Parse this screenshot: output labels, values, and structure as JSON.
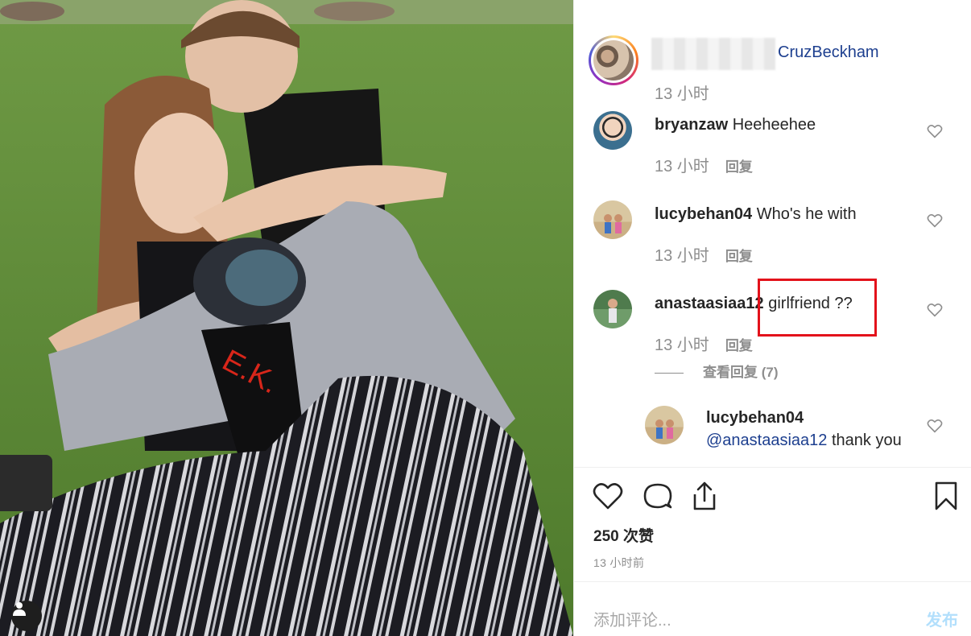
{
  "post": {
    "author": "CruzBeckham",
    "time": "13 小时",
    "likes": "250 次赞",
    "posted_ago": "13 小时前"
  },
  "comments": [
    {
      "user": "bryanzaw",
      "text": "Heeheehee",
      "time": "13 小时",
      "reply": "回复"
    },
    {
      "user": "lucybehan04",
      "text": "Who's he with",
      "time": "13 小时",
      "reply": "回复"
    },
    {
      "user": "anastaasiaa12",
      "text": "girlfriend ??",
      "time": "13 小时",
      "reply": "回复"
    }
  ],
  "view_replies": "查看回复 (7)",
  "reply": {
    "user": "lucybehan04",
    "mention": "@anastaasiaa12",
    "text": "thank you"
  },
  "input": {
    "placeholder": "添加评论...",
    "post_label": "发布"
  },
  "colors": {
    "highlight": "#e3121b",
    "link": "#1d3f8f",
    "post_button": "#b2dffc"
  },
  "icons": [
    "heart-icon",
    "comment-icon",
    "share-icon",
    "bookmark-icon",
    "user-tag-icon"
  ]
}
